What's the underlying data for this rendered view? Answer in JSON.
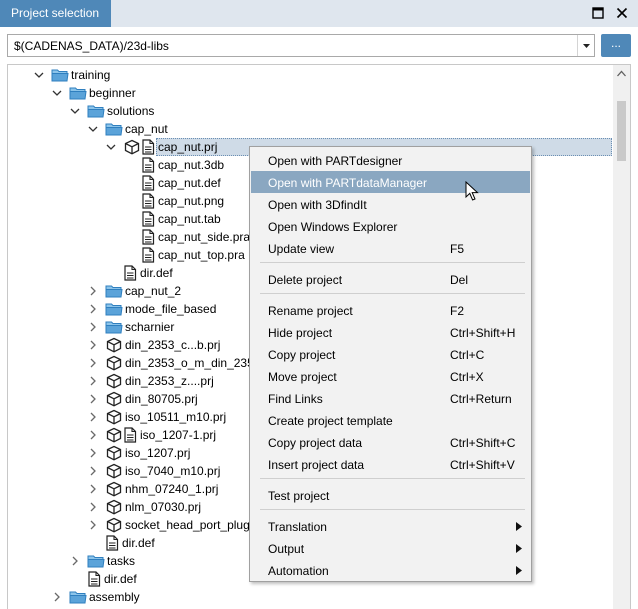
{
  "window": {
    "title": "Project selection"
  },
  "path": {
    "value": "$(CADENAS_DATA)/23d-libs",
    "browse_label": "..."
  },
  "tree": [
    {
      "label": "training"
    },
    {
      "label": "beginner"
    },
    {
      "label": "solutions"
    },
    {
      "label": "cap_nut"
    },
    {
      "label": "cap_nut.prj"
    },
    {
      "label": "cap_nut.3db"
    },
    {
      "label": "cap_nut.def"
    },
    {
      "label": "cap_nut.png"
    },
    {
      "label": "cap_nut.tab"
    },
    {
      "label": "cap_nut_side.pra"
    },
    {
      "label": "cap_nut_top.pra"
    },
    {
      "label": "dir.def"
    },
    {
      "label": "cap_nut_2"
    },
    {
      "label": "mode_file_based"
    },
    {
      "label": "scharnier"
    },
    {
      "label": "din_2353_c...b.prj"
    },
    {
      "label": "din_2353_o_m_din_2353"
    },
    {
      "label": "din_2353_z....prj"
    },
    {
      "label": "din_80705.prj"
    },
    {
      "label": "iso_10511_m10.prj"
    },
    {
      "label": "iso_1207-1.prj"
    },
    {
      "label": "iso_1207.prj"
    },
    {
      "label": "iso_7040_m10.prj"
    },
    {
      "label": "nhm_07240_1.prj"
    },
    {
      "label": "nlm_07030.prj"
    },
    {
      "label": "socket_head_port_plugs"
    },
    {
      "label": "dir.def"
    },
    {
      "label": "tasks"
    },
    {
      "label": "dir.def"
    },
    {
      "label": "assembly"
    }
  ],
  "context_menu": [
    {
      "label": "Open with PARTdesigner",
      "shortcut": ""
    },
    {
      "label": "Open with PARTdataManager",
      "shortcut": ""
    },
    {
      "label": "Open with 3DfindIt",
      "shortcut": ""
    },
    {
      "label": "Open Windows Explorer",
      "shortcut": ""
    },
    {
      "label": "Update view",
      "shortcut": "F5"
    },
    {
      "label": "Delete project",
      "shortcut": "Del"
    },
    {
      "label": "Rename project",
      "shortcut": "F2"
    },
    {
      "label": "Hide project",
      "shortcut": "Ctrl+Shift+H"
    },
    {
      "label": "Copy project",
      "shortcut": "Ctrl+C"
    },
    {
      "label": "Move project",
      "shortcut": "Ctrl+X"
    },
    {
      "label": "Find Links",
      "shortcut": "Ctrl+Return"
    },
    {
      "label": "Create project template",
      "shortcut": ""
    },
    {
      "label": "Copy project data",
      "shortcut": "Ctrl+Shift+C"
    },
    {
      "label": "Insert project data",
      "shortcut": "Ctrl+Shift+V"
    },
    {
      "label": "Test project",
      "shortcut": ""
    },
    {
      "label": "Translation",
      "shortcut": ""
    },
    {
      "label": "Output",
      "shortcut": ""
    },
    {
      "label": "Automation",
      "shortcut": ""
    }
  ],
  "colors": {
    "accent": "#4f88b8",
    "folder": "#5ba3d9",
    "menu_hover": "#8aa7c1",
    "selection": "#cfdbe7"
  }
}
